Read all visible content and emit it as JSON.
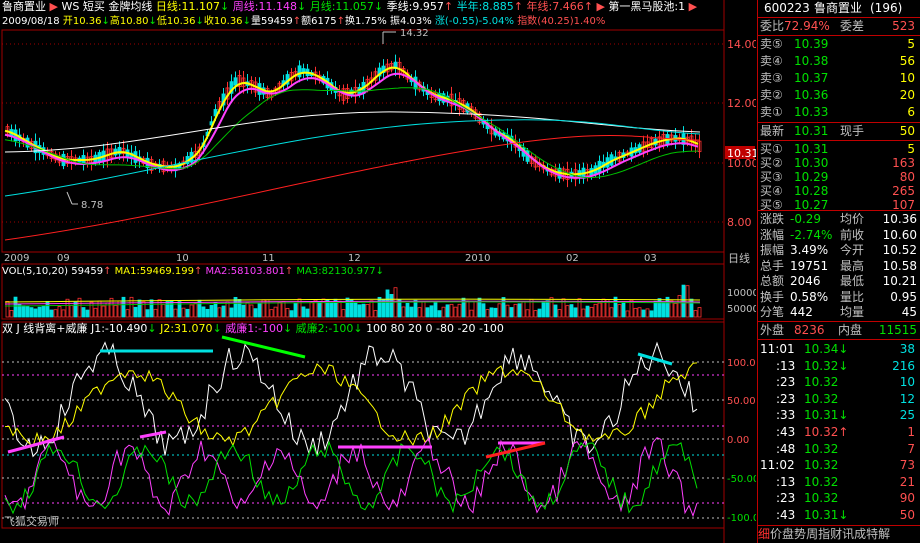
{
  "header": {
    "stock_name": "鲁商置业",
    "ws": "WS",
    "indicator_menu": "短买",
    "indicator_name": "金牌均线",
    "day_line_label": "日线:",
    "day_line_value": "11.107",
    "week_line_label": "周线:",
    "week_line_value": "11.148",
    "month_line_label": "月线:",
    "month_line_value": "11.057",
    "season_line_label": "季线:",
    "season_line_value": "9.957",
    "half_year_label": "半年:",
    "half_year_value": "8.885",
    "year_line_label": "年线:",
    "year_line_value": "7.466",
    "pool_label": "第一黑马股池:",
    "pool_value": "1"
  },
  "info_line": {
    "date": "2009/08/18",
    "open": "开10.36",
    "high": "高10.80",
    "low": "低10.36",
    "close": "收10.36",
    "volume": "量59459",
    "amount": "额6175",
    "turnover": "换1.75%",
    "amplitude": "振4.03%",
    "change": "涨(-0.55)-5.04%",
    "index_label": "指数",
    "index_value": "(40.25)1.40%"
  },
  "price_chart": {
    "y_ticks": [
      "14.00",
      "12.00",
      "10.00",
      "8.00"
    ],
    "max_marker": "14.32",
    "min_marker": "8.78",
    "current_price_tag": "10.31"
  },
  "x_axis": {
    "labels": [
      "2009",
      "09",
      "10",
      "11",
      "12",
      "2010",
      "02",
      "03"
    ],
    "period": "日线"
  },
  "volume_panel": {
    "title": "VOL(5,10,20)",
    "vol": "59459",
    "ma1": "MA1:59469.199",
    "ma2": "MA2:58103.801",
    "ma3": "MA3:82130.977",
    "y_ticks": [
      "100000",
      "50000"
    ]
  },
  "oscillator_panel": {
    "title": "双 J 线背离+威廉",
    "j1": "J1:-10.490",
    "j2": "J2:31.070",
    "wr1": "威廉1:-100",
    "wr2": "威廉2:-100",
    "levels": "100  80  20  0  -80  -20  -100",
    "y_ticks": [
      "100.00",
      "50.00",
      "0.00",
      "-50.00",
      "-100.0"
    ],
    "watermark": "飞狐交易师"
  },
  "quote_panel": {
    "code": "600223",
    "name": "鲁商置业",
    "rank": "(196)",
    "weibi_label": "委比",
    "weibi_value": "72.94%",
    "weicha_label": "委差",
    "weicha_value": "523",
    "asks": [
      {
        "label": "卖⑤",
        "price": "10.39",
        "vol": "5"
      },
      {
        "label": "卖④",
        "price": "10.38",
        "vol": "56"
      },
      {
        "label": "卖③",
        "price": "10.37",
        "vol": "10"
      },
      {
        "label": "卖②",
        "price": "10.36",
        "vol": "20"
      },
      {
        "label": "卖①",
        "price": "10.33",
        "vol": "6"
      }
    ],
    "latest_label": "最新",
    "latest_value": "10.31",
    "current_hand_label": "现手",
    "current_hand_value": "50",
    "bids": [
      {
        "label": "买①",
        "price": "10.31",
        "vol": "5"
      },
      {
        "label": "买②",
        "price": "10.30",
        "vol": "163"
      },
      {
        "label": "买③",
        "price": "10.29",
        "vol": "80"
      },
      {
        "label": "买④",
        "price": "10.28",
        "vol": "265"
      },
      {
        "label": "买⑤",
        "price": "10.27",
        "vol": "107"
      }
    ],
    "stats": [
      {
        "l1": "涨跌",
        "v1": "-0.29",
        "l2": "均价",
        "v2": "10.36"
      },
      {
        "l1": "涨幅",
        "v1": "-2.74%",
        "l2": "前收",
        "v2": "10.60"
      },
      {
        "l1": "振幅",
        "v1": "3.49%",
        "l2": "今开",
        "v2": "10.52"
      },
      {
        "l1": "总手",
        "v1": "19751",
        "l2": "最高",
        "v2": "10.58"
      },
      {
        "l1": "总额",
        "v1": "2046",
        "l2": "最低",
        "v2": "10.21"
      },
      {
        "l1": "换手",
        "v1": "0.58%",
        "l2": "量比",
        "v2": "0.95"
      },
      {
        "l1": "分笔",
        "v1": "442",
        "l2": "均量",
        "v2": "45"
      }
    ],
    "outer_label": "外盘",
    "outer_value": "8236",
    "inner_label": "内盘",
    "inner_value": "11515",
    "ticks": [
      {
        "time": "11:01",
        "price": "10.34",
        "arrow": "↓",
        "vol": "38"
      },
      {
        "time": ":13",
        "price": "10.32",
        "arrow": "↓",
        "vol": "216"
      },
      {
        "time": ":23",
        "price": "10.32",
        "arrow": "",
        "vol": "10"
      },
      {
        "time": ":23",
        "price": "10.32",
        "arrow": "",
        "vol": "12"
      },
      {
        "time": ":33",
        "price": "10.31",
        "arrow": "↓",
        "vol": "25"
      },
      {
        "time": ":43",
        "price": "10.32",
        "arrow": "↑",
        "vol": "1"
      },
      {
        "time": ":48",
        "price": "10.32",
        "arrow": "",
        "vol": "7"
      },
      {
        "time": "11:02",
        "price": "10.32",
        "arrow": "",
        "vol": "73"
      },
      {
        "time": ":13",
        "price": "10.32",
        "arrow": "",
        "vol": "21"
      },
      {
        "time": ":23",
        "price": "10.32",
        "arrow": "",
        "vol": "90"
      },
      {
        "time": ":43",
        "price": "10.31",
        "arrow": "↓",
        "vol": "50"
      }
    ],
    "tabs": [
      "细",
      "价",
      "盘",
      "势",
      "周",
      "指",
      "财",
      "讯",
      "成",
      "特",
      "解"
    ]
  },
  "colors": {
    "up": "#ff5050",
    "down": "#00e0e0",
    "grid": "#a00000",
    "yellow": "#ffff00",
    "magenta": "#ff40ff",
    "white": "#ffffff"
  }
}
